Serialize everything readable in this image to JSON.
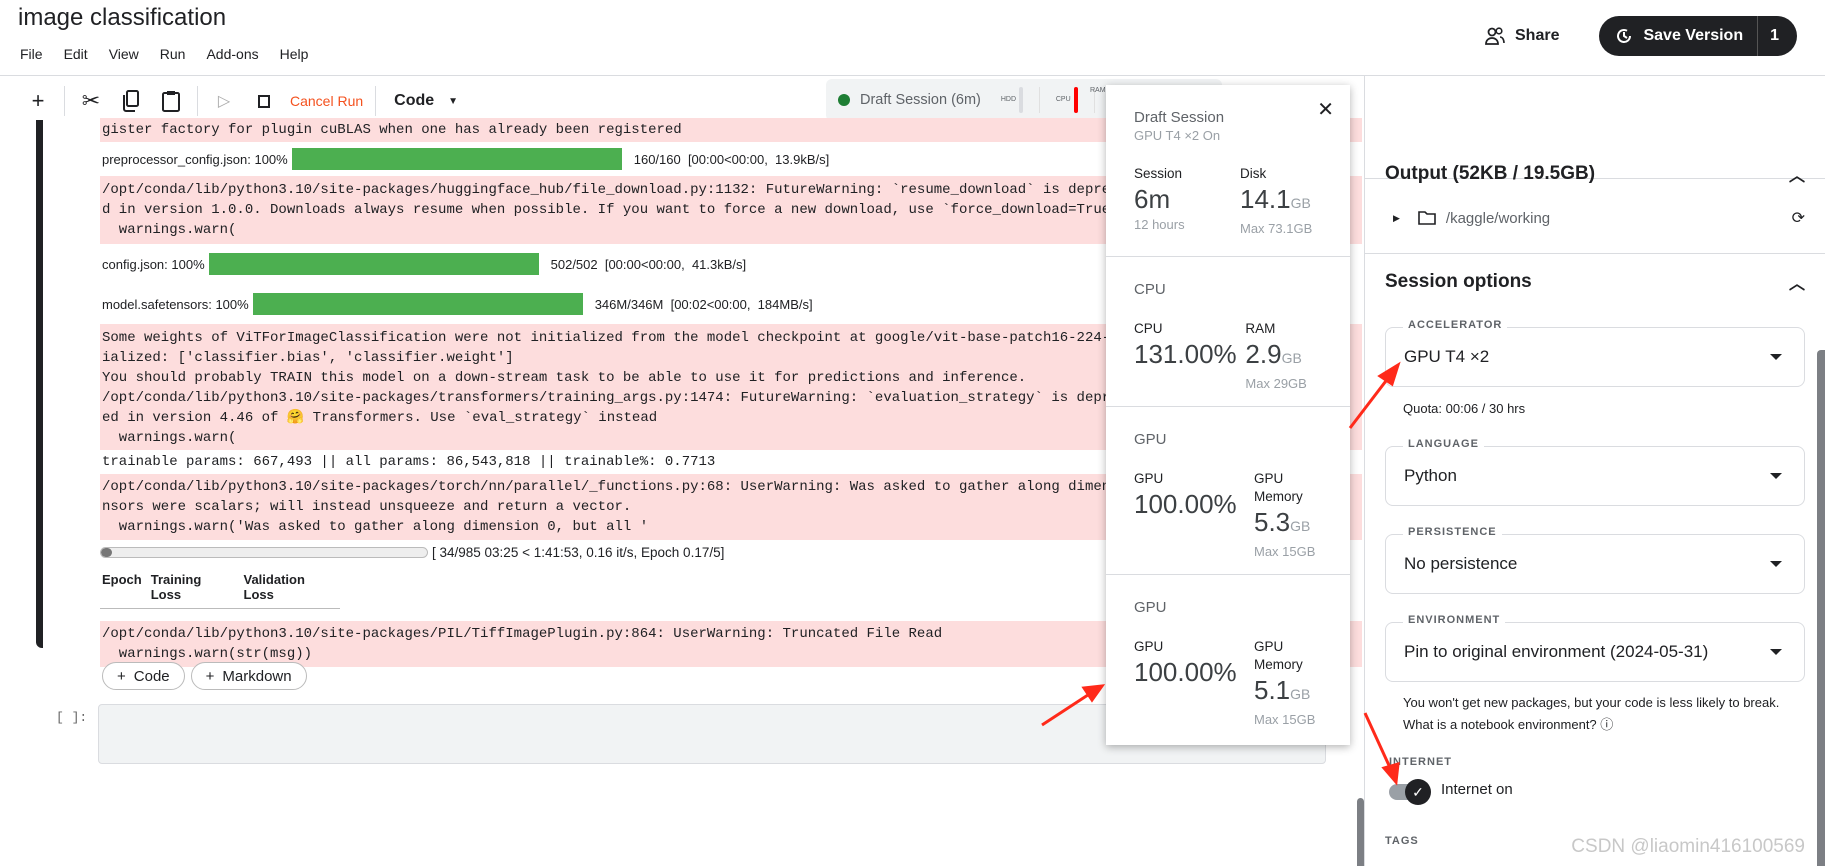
{
  "header": {
    "title": "image classification",
    "menu": [
      "File",
      "Edit",
      "View",
      "Run",
      "Add-ons",
      "Help"
    ],
    "share_label": "Share",
    "save_version_label": "Save Version",
    "save_version_count": "1"
  },
  "toolbar": {
    "cancel_run_label": "Cancel Run",
    "cell_type": "Code"
  },
  "session_pill": {
    "label": "Draft Session (6m)",
    "status_color": "#1e7e34",
    "hdd": "HDD",
    "cpu": "CPU",
    "ram": "RAM",
    "cpu_bar_color": "#ff0000"
  },
  "output": {
    "line0": "gister factory for plugin cuBLAS when one has already been registered",
    "downloads": [
      {
        "name": "preprocessor_config.json: 100%",
        "progress": 100,
        "stats": "160/160  [00:00<00:00,  13.9kB/s]"
      },
      {
        "name": "config.json: 100%",
        "progress": 100,
        "stats": "502/502  [00:00<00:00,  41.3kB/s]"
      },
      {
        "name": "model.safetensors: 100%",
        "progress": 100,
        "stats": "346M/346M  [00:02<00:00,  184MB/s]"
      }
    ],
    "warn1": "/opt/conda/lib/python3.10/site-packages/huggingface_hub/file_download.py:1132: FutureWarning: `resume_download` is deprecated and will be removed\nd in version 1.0.0. Downloads always resume when possible. If you want to force a new download, use `force_download=True`.\n  warnings.warn(",
    "warn2": "Some weights of ViTForImageClassification were not initialized from the model checkpoint at google/vit-base-patch16-224-in21k and are newly init\nialized: ['classifier.bias', 'classifier.weight']\nYou should probably TRAIN this model on a down-stream task to be able to use it for predictions and inference.\n/opt/conda/lib/python3.10/site-packages/transformers/training_args.py:1474: FutureWarning: `evaluation_strategy` is deprecated and will be remov\ned in version 4.46 of 🤗 Transformers. Use `eval_strategy` instead\n  warnings.warn(",
    "params": "trainable params: 667,493 || all params: 86,543,818 || trainable%: 0.7713",
    "warn3": "/opt/conda/lib/python3.10/site-packages/torch/nn/parallel/_functions.py:68: UserWarning: Was asked to gather along dimension 0, but all input te\nnsors were scalars; will instead unsqueeze and return a vector.\n  warnings.warn('Was asked to gather along dimension 0, but all '",
    "training": {
      "progress_fraction": 0.0345,
      "stats": "[ 34/985 03:25 < 1:41:53, 0.16 it/s, Epoch 0.17/5]",
      "columns": [
        "Epoch",
        "Training Loss",
        "Validation Loss"
      ]
    },
    "warn4": "/opt/conda/lib/python3.10/site-packages/PIL/TiffImagePlugin.py:864: UserWarning: Truncated File Read\n  warnings.warn(str(msg))"
  },
  "cell_buttons": {
    "code": "Code",
    "markdown": "Markdown"
  },
  "empty_cell_prompt": "[ ]:",
  "popup": {
    "title": "Draft Session",
    "subtitle": "GPU T4 ×2 On",
    "session": {
      "label": "Session",
      "value": "6m",
      "sub": "12 hours"
    },
    "disk": {
      "label": "Disk",
      "value": "14.1",
      "unit": "GB",
      "max": "Max 73.1GB"
    },
    "cpu_section": {
      "title": "CPU",
      "cpu_label": "CPU",
      "cpu_value": "131.00%",
      "ram_label": "RAM",
      "ram_value": "2.9",
      "ram_unit": "GB",
      "ram_max": "Max 29GB"
    },
    "gpus": [
      {
        "title": "GPU",
        "gpu_label": "GPU",
        "gpu_value": "100.00%",
        "mem_label": "GPU Memory",
        "mem_value": "5.3",
        "mem_unit": "GB",
        "mem_max": "Max 15GB"
      },
      {
        "title": "GPU",
        "gpu_label": "GPU",
        "gpu_value": "100.00%",
        "mem_label": "GPU Memory",
        "mem_value": "5.1",
        "mem_unit": "GB",
        "mem_max": "Max 15GB"
      }
    ]
  },
  "right_panel": {
    "output_title": "Output (52KB / 19.5GB)",
    "output_path": "/kaggle/working",
    "session_options_title": "Session options",
    "accelerator": {
      "label": "ACCELERATOR",
      "value": "GPU T4 ×2"
    },
    "quota": "Quota: 00:06 / 30 hrs",
    "language": {
      "label": "LANGUAGE",
      "value": "Python"
    },
    "persistence": {
      "label": "PERSISTENCE",
      "value": "No persistence"
    },
    "environment": {
      "label": "ENVIRONMENT",
      "value": "Pin to original environment (2024-05-31)"
    },
    "env_help": "You won't get new packages, but your code is less likely to break. What is a notebook environment?",
    "internet_label": "INTERNET",
    "internet_toggle": "Internet on",
    "internet_on": true,
    "tags_label": "TAGS"
  },
  "watermark": "CSDN @liaomin416100569",
  "annotation_color": "#ff2a1a"
}
